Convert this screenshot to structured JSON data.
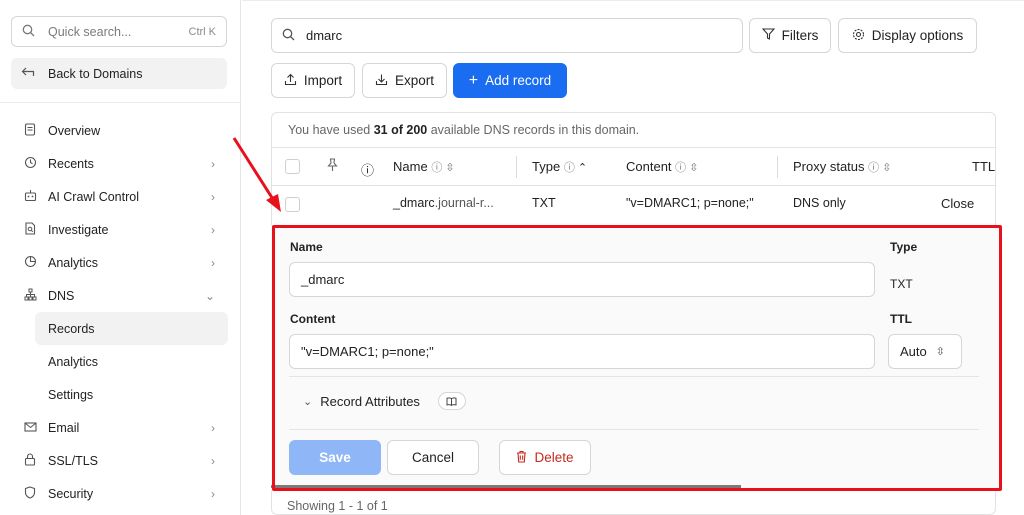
{
  "sidebar": {
    "search_placeholder": "Quick search...",
    "search_shortcut": "Ctrl K",
    "back_label": "Back to Domains",
    "items": [
      {
        "label": "Overview",
        "icon": "document-icon"
      },
      {
        "label": "Recents",
        "icon": "clock-icon"
      },
      {
        "label": "AI Crawl Control",
        "icon": "robot-icon"
      },
      {
        "label": "Investigate",
        "icon": "file-search-icon"
      },
      {
        "label": "Analytics",
        "icon": "pie-chart-icon"
      },
      {
        "label": "DNS",
        "icon": "network-icon"
      }
    ],
    "dns_sub": [
      "Records",
      "Analytics",
      "Settings"
    ],
    "items_after": [
      {
        "label": "Email",
        "icon": "email-icon"
      },
      {
        "label": "SSL/TLS",
        "icon": "lock-icon"
      },
      {
        "label": "Security",
        "icon": "shield-icon"
      }
    ]
  },
  "main": {
    "search_value": "dmarc",
    "filters_label": "Filters",
    "display_options_label": "Display options",
    "import_label": "Import",
    "export_label": "Export",
    "add_record_label": "Add record",
    "usage_prefix": "You have used ",
    "usage_bold": "31 of 200",
    "usage_suffix": " available DNS records in this domain.",
    "columns": {
      "name": "Name",
      "type": "Type",
      "content": "Content",
      "proxy": "Proxy status",
      "ttl": "TTL"
    },
    "row": {
      "name_bold": "_dmarc",
      "name_rest": ".journal-r...",
      "type": "TXT",
      "content": "\"v=DMARC1; p=none;\"",
      "proxy": "DNS only",
      "action": "Close"
    },
    "edit": {
      "name_label": "Name",
      "name_value": "_dmarc",
      "type_label": "Type",
      "type_value": "TXT",
      "content_label": "Content",
      "content_value": "\"v=DMARC1; p=none;\"",
      "ttl_label": "TTL",
      "ttl_value": "Auto",
      "attributes_label": "Record Attributes",
      "save_label": "Save",
      "cancel_label": "Cancel",
      "delete_label": "Delete"
    },
    "footer": "Showing 1 - 1 of 1"
  },
  "colors": {
    "accent": "#1a6cf0",
    "annotation": "#e8101a",
    "danger": "#c42b1c"
  }
}
